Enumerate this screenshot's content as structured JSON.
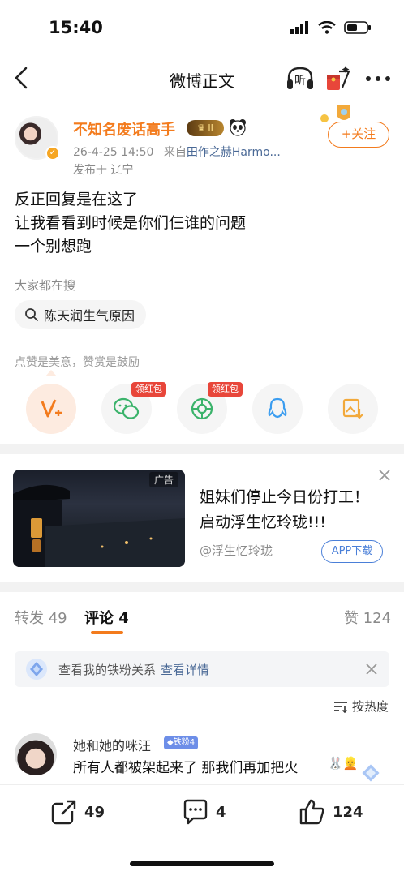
{
  "status_bar": {
    "time": "15:40"
  },
  "nav": {
    "title": "微博正文",
    "listen_label": "听"
  },
  "post": {
    "username": "不知名废话高手",
    "vip_level": "♛ II",
    "timestamp": "26-4-25 14:50",
    "source_prefix": "来自",
    "source": "田作之赫Harmo...",
    "location": "发布于 辽宁",
    "follow_label": "+关注",
    "body_lines": [
      "反正回复是在这了",
      "让我看看到时候是你们仨谁的问题",
      "一个别想跑"
    ]
  },
  "hot_search": {
    "title": "大家都在搜",
    "chip": "陈天润生气原因"
  },
  "like_hint": "点赞是美意，赞赏是鼓励",
  "share_tags": {
    "wechat": "领红包",
    "moments": "领红包"
  },
  "ad": {
    "tag": "广告",
    "line1": "姐妹们停止今日份打工！",
    "line2": "启动浮生忆玲珑!!!",
    "account": "@浮生忆玲珑",
    "button": "APP下载"
  },
  "tabs": {
    "repost": "转发 49",
    "comment": "评论 4",
    "like": "赞 124"
  },
  "fan_banner": {
    "text": "查看我的铁粉关系",
    "link": "查看详情"
  },
  "sort": {
    "label": "按热度"
  },
  "comment": {
    "name": "她和她的咪汪",
    "badge": "◆铁粉4",
    "text": "所有人都被架起来了 那我们再加把火",
    "emoji": "🐰👱"
  },
  "bottom_bar": {
    "repost": "49",
    "comment": "4",
    "like": "124"
  },
  "colors": {
    "accent": "#f37b1d",
    "link": "#4a6996",
    "red_tag": "#e8463a"
  }
}
